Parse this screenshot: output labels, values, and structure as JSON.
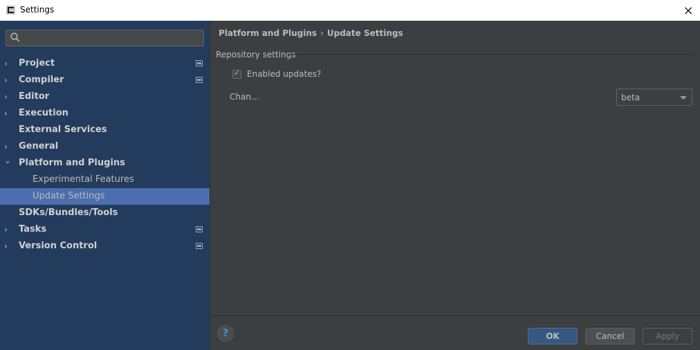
{
  "window": {
    "title": "Settings",
    "close_icon": "×"
  },
  "sidebar": {
    "search": {
      "value": "",
      "placeholder": ""
    },
    "items": [
      {
        "label": "Project",
        "arrow": "›",
        "level": 0,
        "has_project_icon": true
      },
      {
        "label": "Compiler",
        "arrow": "›",
        "level": 0,
        "has_project_icon": true
      },
      {
        "label": "Editor",
        "arrow": "›",
        "level": 0,
        "has_project_icon": false
      },
      {
        "label": "Execution",
        "arrow": "›",
        "level": 0,
        "has_project_icon": false
      },
      {
        "label": "External Services",
        "arrow": "",
        "level": 0,
        "has_project_icon": false
      },
      {
        "label": "General",
        "arrow": "›",
        "level": 0,
        "has_project_icon": false
      },
      {
        "label": "Platform and Plugins",
        "arrow": "⌄",
        "level": 0,
        "has_project_icon": false,
        "expanded": true
      },
      {
        "label": "Experimental Features",
        "arrow": "",
        "level": 1,
        "has_project_icon": false
      },
      {
        "label": "Update Settings",
        "arrow": "",
        "level": 1,
        "has_project_icon": false,
        "selected": true
      },
      {
        "label": "SDKs/Bundles/Tools",
        "arrow": "",
        "level": 0,
        "has_project_icon": false
      },
      {
        "label": "Tasks",
        "arrow": "›",
        "level": 0,
        "has_project_icon": true
      },
      {
        "label": "Version Control",
        "arrow": "›",
        "level": 0,
        "has_project_icon": true
      }
    ]
  },
  "main": {
    "breadcrumb": {
      "parent": "Platform and Plugins",
      "separator": "›",
      "current": "Update Settings"
    },
    "section_title": "Repository settings",
    "enabled_updates": {
      "label": "Enabled updates?",
      "checked": true,
      "check_glyph": "✓"
    },
    "channel": {
      "label": "Chan...",
      "value": "beta"
    }
  },
  "footer": {
    "help": "?",
    "ok": "OK",
    "cancel": "Cancel",
    "apply": "Apply"
  }
}
